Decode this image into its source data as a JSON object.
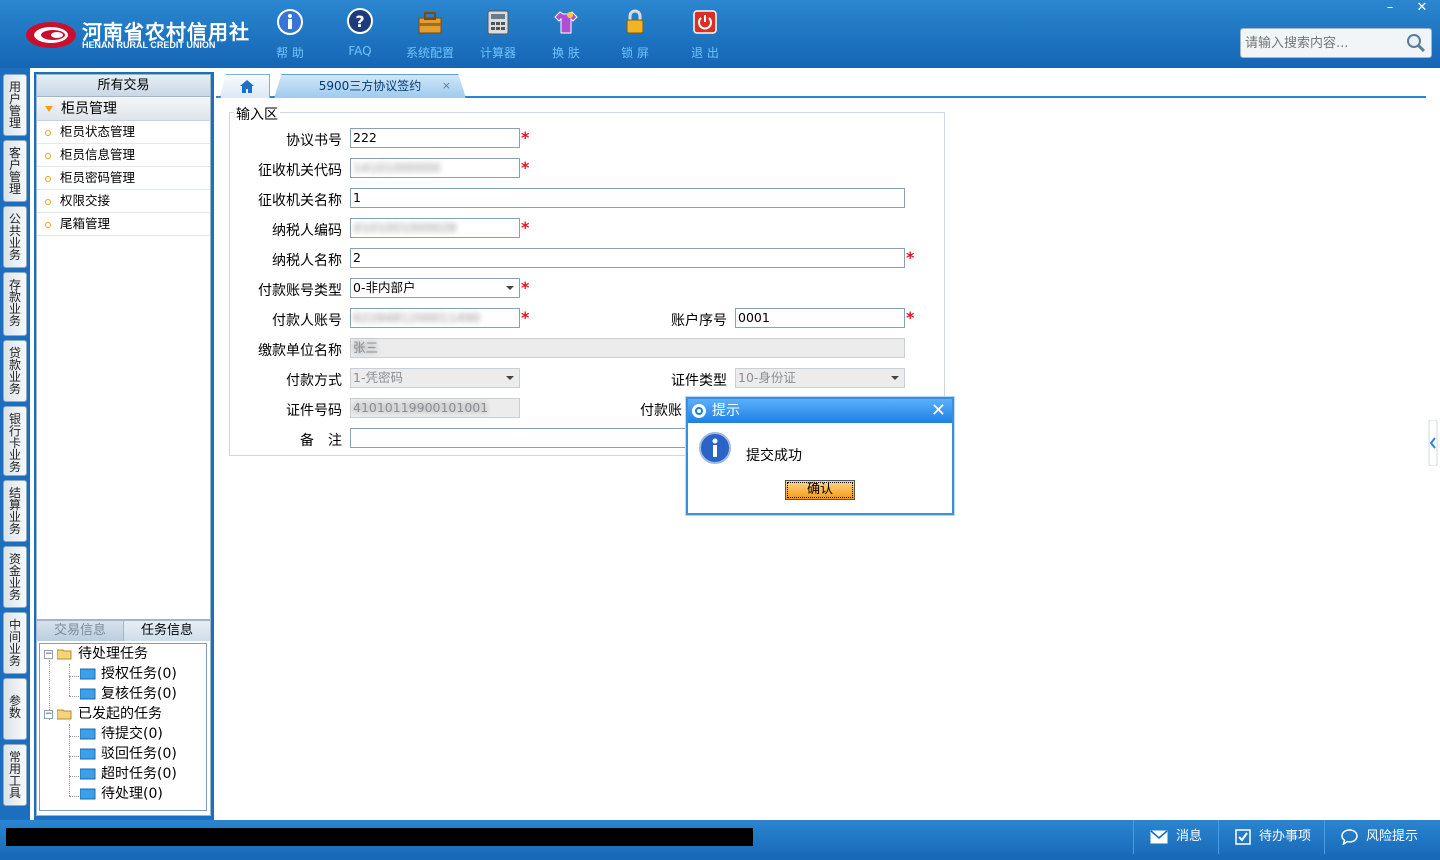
{
  "app": {
    "logo_cn": "河南省农村信用社",
    "logo_en": "HENAN RURAL CREDIT UNION"
  },
  "toolbar": {
    "help": "帮 助",
    "faq": "FAQ",
    "sysconfig": "系统配置",
    "calculator": "计算器",
    "skin": "换 肤",
    "lock": "锁 屏",
    "exit": "退 出"
  },
  "window_controls": {
    "minimize": "–",
    "close": "✕"
  },
  "search": {
    "placeholder": "请输入搜索内容..."
  },
  "side_tabs": [
    "用户管理",
    "客户管理",
    "公共业务",
    "存款业务",
    "贷款业务",
    "银行卡业务",
    "结算业务",
    "资金业务",
    "中间业务",
    "参数",
    "常用工具"
  ],
  "menu": {
    "header": "所有交易",
    "group": "柜员管理",
    "items": [
      "柜员状态管理",
      "柜员信息管理",
      "柜员密码管理",
      "权限交接",
      "尾箱管理"
    ]
  },
  "tasks": {
    "tab_trade": "交易信息",
    "tab_task": "任务信息",
    "pending_group": "待处理任务",
    "authorize": "授权任务(0)",
    "review": "复核任务(0)",
    "initiated_group": "已发起的任务",
    "to_submit": "待提交(0)",
    "rejected": "驳回任务(0)",
    "timeout": "超时任务(0)",
    "to_process": "待处理(0)"
  },
  "tabs": {
    "active": "5900三方协议签约",
    "close": "×"
  },
  "form": {
    "legend": "输入区",
    "agreement_no_label": "协议书号",
    "agreement_no": "222",
    "tax_office_code_label": "征收机关代码",
    "tax_office_code": "14101000000",
    "tax_office_name_label": "征收机关名称",
    "tax_office_name": "1",
    "taxpayer_code_label": "纳税人编码",
    "taxpayer_code": "4101001000028",
    "taxpayer_name_label": "纳税人名称",
    "taxpayer_name": "2",
    "pay_acct_type_label": "付款账号类型",
    "pay_acct_type": "0-非内部户",
    "payer_acct_label": "付款人账号",
    "payer_acct": "6228481200011490",
    "acct_seq_label": "账户序号",
    "acct_seq": "0001",
    "pay_unit_name_label": "缴款单位名称",
    "pay_unit_name": "张三",
    "pay_method_label": "付款方式",
    "pay_method": "1-凭密码",
    "id_type_label": "证件类型",
    "id_type": "10-身份证",
    "id_no_label": "证件号码",
    "id_no": "41010119900101001",
    "pay_acct_label_partial": "付款账",
    "remark_label": "备　注",
    "remark": ""
  },
  "dialog": {
    "title": "提示",
    "message": "提交成功",
    "ok": "确认",
    "close": "✕"
  },
  "statusbar": {
    "messages": "消息",
    "todo": "待办事项",
    "risk": "风险提示"
  },
  "colors": {
    "header_blue": "#1466b4",
    "required_red": "#e0141e",
    "menu_dot_orange": "#f0a020",
    "dialog_button_orange": "#f39a15"
  }
}
